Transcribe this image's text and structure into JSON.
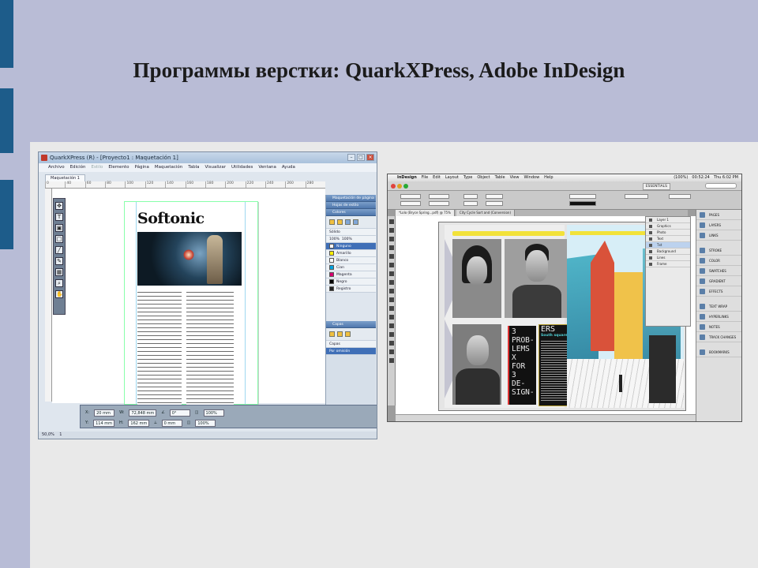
{
  "slide": {
    "title": "Программы верстки: QuarkXPress, Adobe InDesign"
  },
  "quark": {
    "window_title": "QuarkXPress (R) - [Proyecto1 : Maquetación 1]",
    "menu": [
      "Archivo",
      "Edición",
      "Estilo",
      "Elemento",
      "Página",
      "Maquetación",
      "Tabla",
      "Visualizar",
      "Utilidades",
      "Ventana",
      "Ayuda"
    ],
    "layout_tab": "Maquetación 1",
    "ruler_marks": [
      "0",
      "40",
      "60",
      "80",
      "100",
      "120",
      "140",
      "160",
      "180",
      "200",
      "220",
      "240",
      "260",
      "280"
    ],
    "page_heading": "Softonic",
    "panels": {
      "layout_panel": "Maquetación de página",
      "style_sheets": "Hojas de estilo",
      "colors": "Colores",
      "fill_mode": "Sólido",
      "opacity_1": "100%",
      "opacity_2": "100%",
      "color_list": [
        "Ninguno",
        "Amarillo",
        "Blanco",
        "Cian",
        "Magenta",
        "Negro",
        "Registro"
      ],
      "layers": "Capas",
      "layers_header": "Capas",
      "default_layer": "Por omisión"
    },
    "measurements": {
      "x": "20 mm",
      "y": "114 mm",
      "w": "72,848 mm",
      "h": "162 mm",
      "angle": "0°",
      "skew": "0 mm",
      "opacity_a": "100%",
      "opacity_b": "100%"
    },
    "zoom": "50,0%",
    "page_field": "1"
  },
  "indesign": {
    "menu": [
      "InDesign",
      "File",
      "Edit",
      "Layout",
      "Type",
      "Object",
      "Table",
      "View",
      "Window",
      "Help"
    ],
    "menu_right": [
      "(100%)",
      "00:52:24",
      "Thu 6:02 PM"
    ],
    "workspace": "ESSENTIALS",
    "doc_tabs": [
      "*Lolo (Bryce Spring...pdf) @ 75%",
      "City Cycle Sort and (Conversion)"
    ],
    "poster_text": "3 PROB- LEMS X FOR 3 DE- SIGN-",
    "poster_heading": "ERS",
    "poster_sub": "South square",
    "layers": [
      "Layer 1",
      "Graphics",
      "Photo",
      "Text",
      "Txt",
      "Background",
      "Lines",
      "Frame"
    ],
    "right_panel": [
      "PAGES",
      "LAYERS",
      "LINKS",
      "STROKE",
      "COLOR",
      "SWATCHES",
      "GRADIENT",
      "EFFECTS",
      "TEXT WRAP",
      "HYPERLINKS",
      "NOTES",
      "TRACK CHANGES",
      "BOOKMARKS"
    ]
  }
}
